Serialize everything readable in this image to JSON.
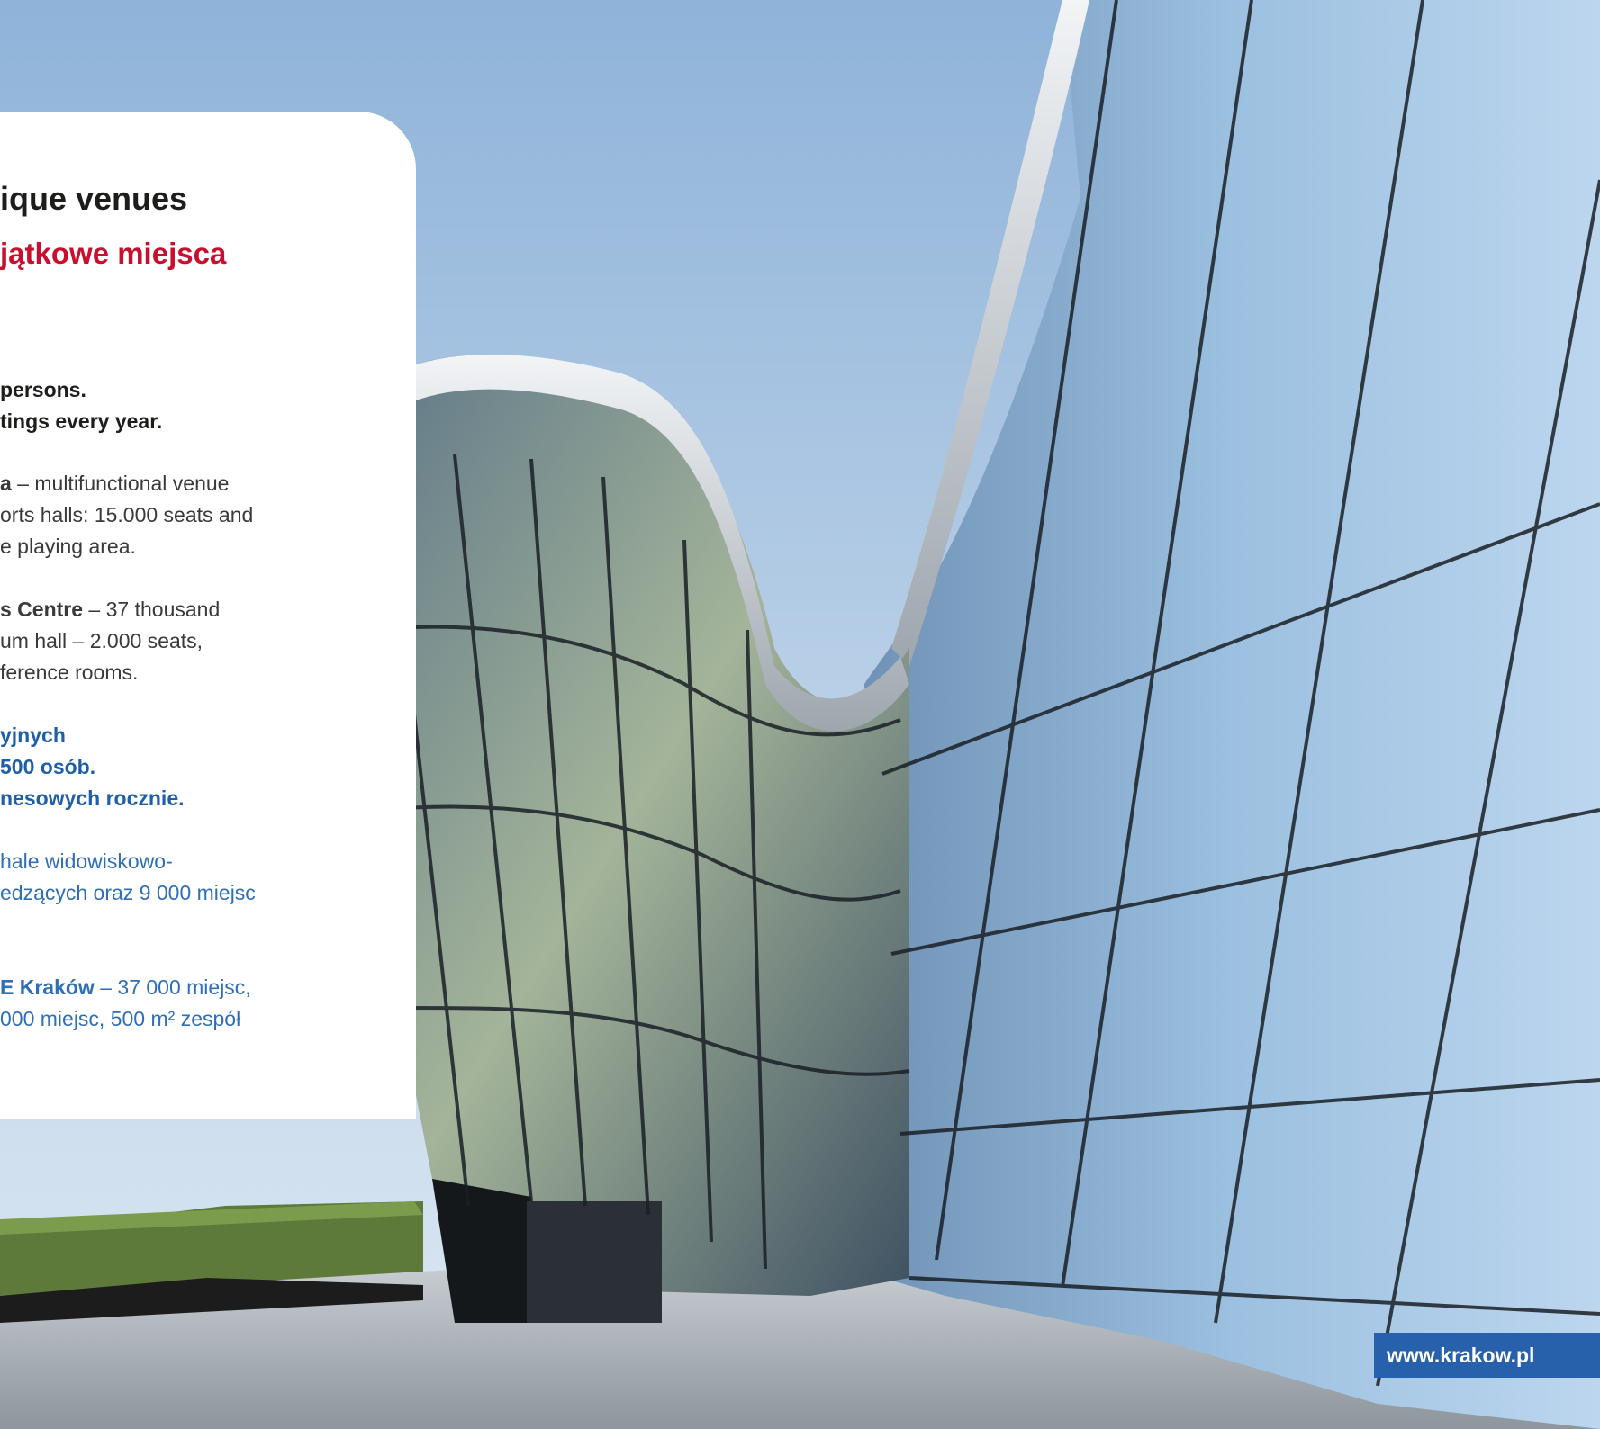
{
  "heading": {
    "en": "ique venues",
    "pl": "jątkowe miejsca"
  },
  "english": {
    "stats": [
      "persons.",
      "tings every year."
    ],
    "arena_line1_bold": "a",
    "arena_line1_rest": " – multifunctional venue",
    "arena_line2": "orts halls: 15.000 seats and",
    "arena_line3": "e playing area.",
    "centre_line1_bold": "s Centre",
    "centre_line1_rest": " – 37 thousand",
    "centre_line2": "um hall – 2.000 seats,",
    "centre_line3": "ference rooms."
  },
  "polish": {
    "stats": [
      "yjnych",
      "500 osób.",
      "nesowych rocznie."
    ],
    "arena_line1": " hale widowiskowo-",
    "arena_line2": "edzących oraz 9 000 miejsc",
    "centre_line1_bold": "E Kraków",
    "centre_line1_rest": " – 37 000 miejsc,",
    "centre_line2": "000 miejsc, 500 m² zespół"
  },
  "footer": {
    "url": "www.krakow.pl"
  },
  "colors": {
    "title_red": "#c8102e",
    "polish_blue": "#1f5fa8",
    "badge_blue": "#2861ab"
  }
}
